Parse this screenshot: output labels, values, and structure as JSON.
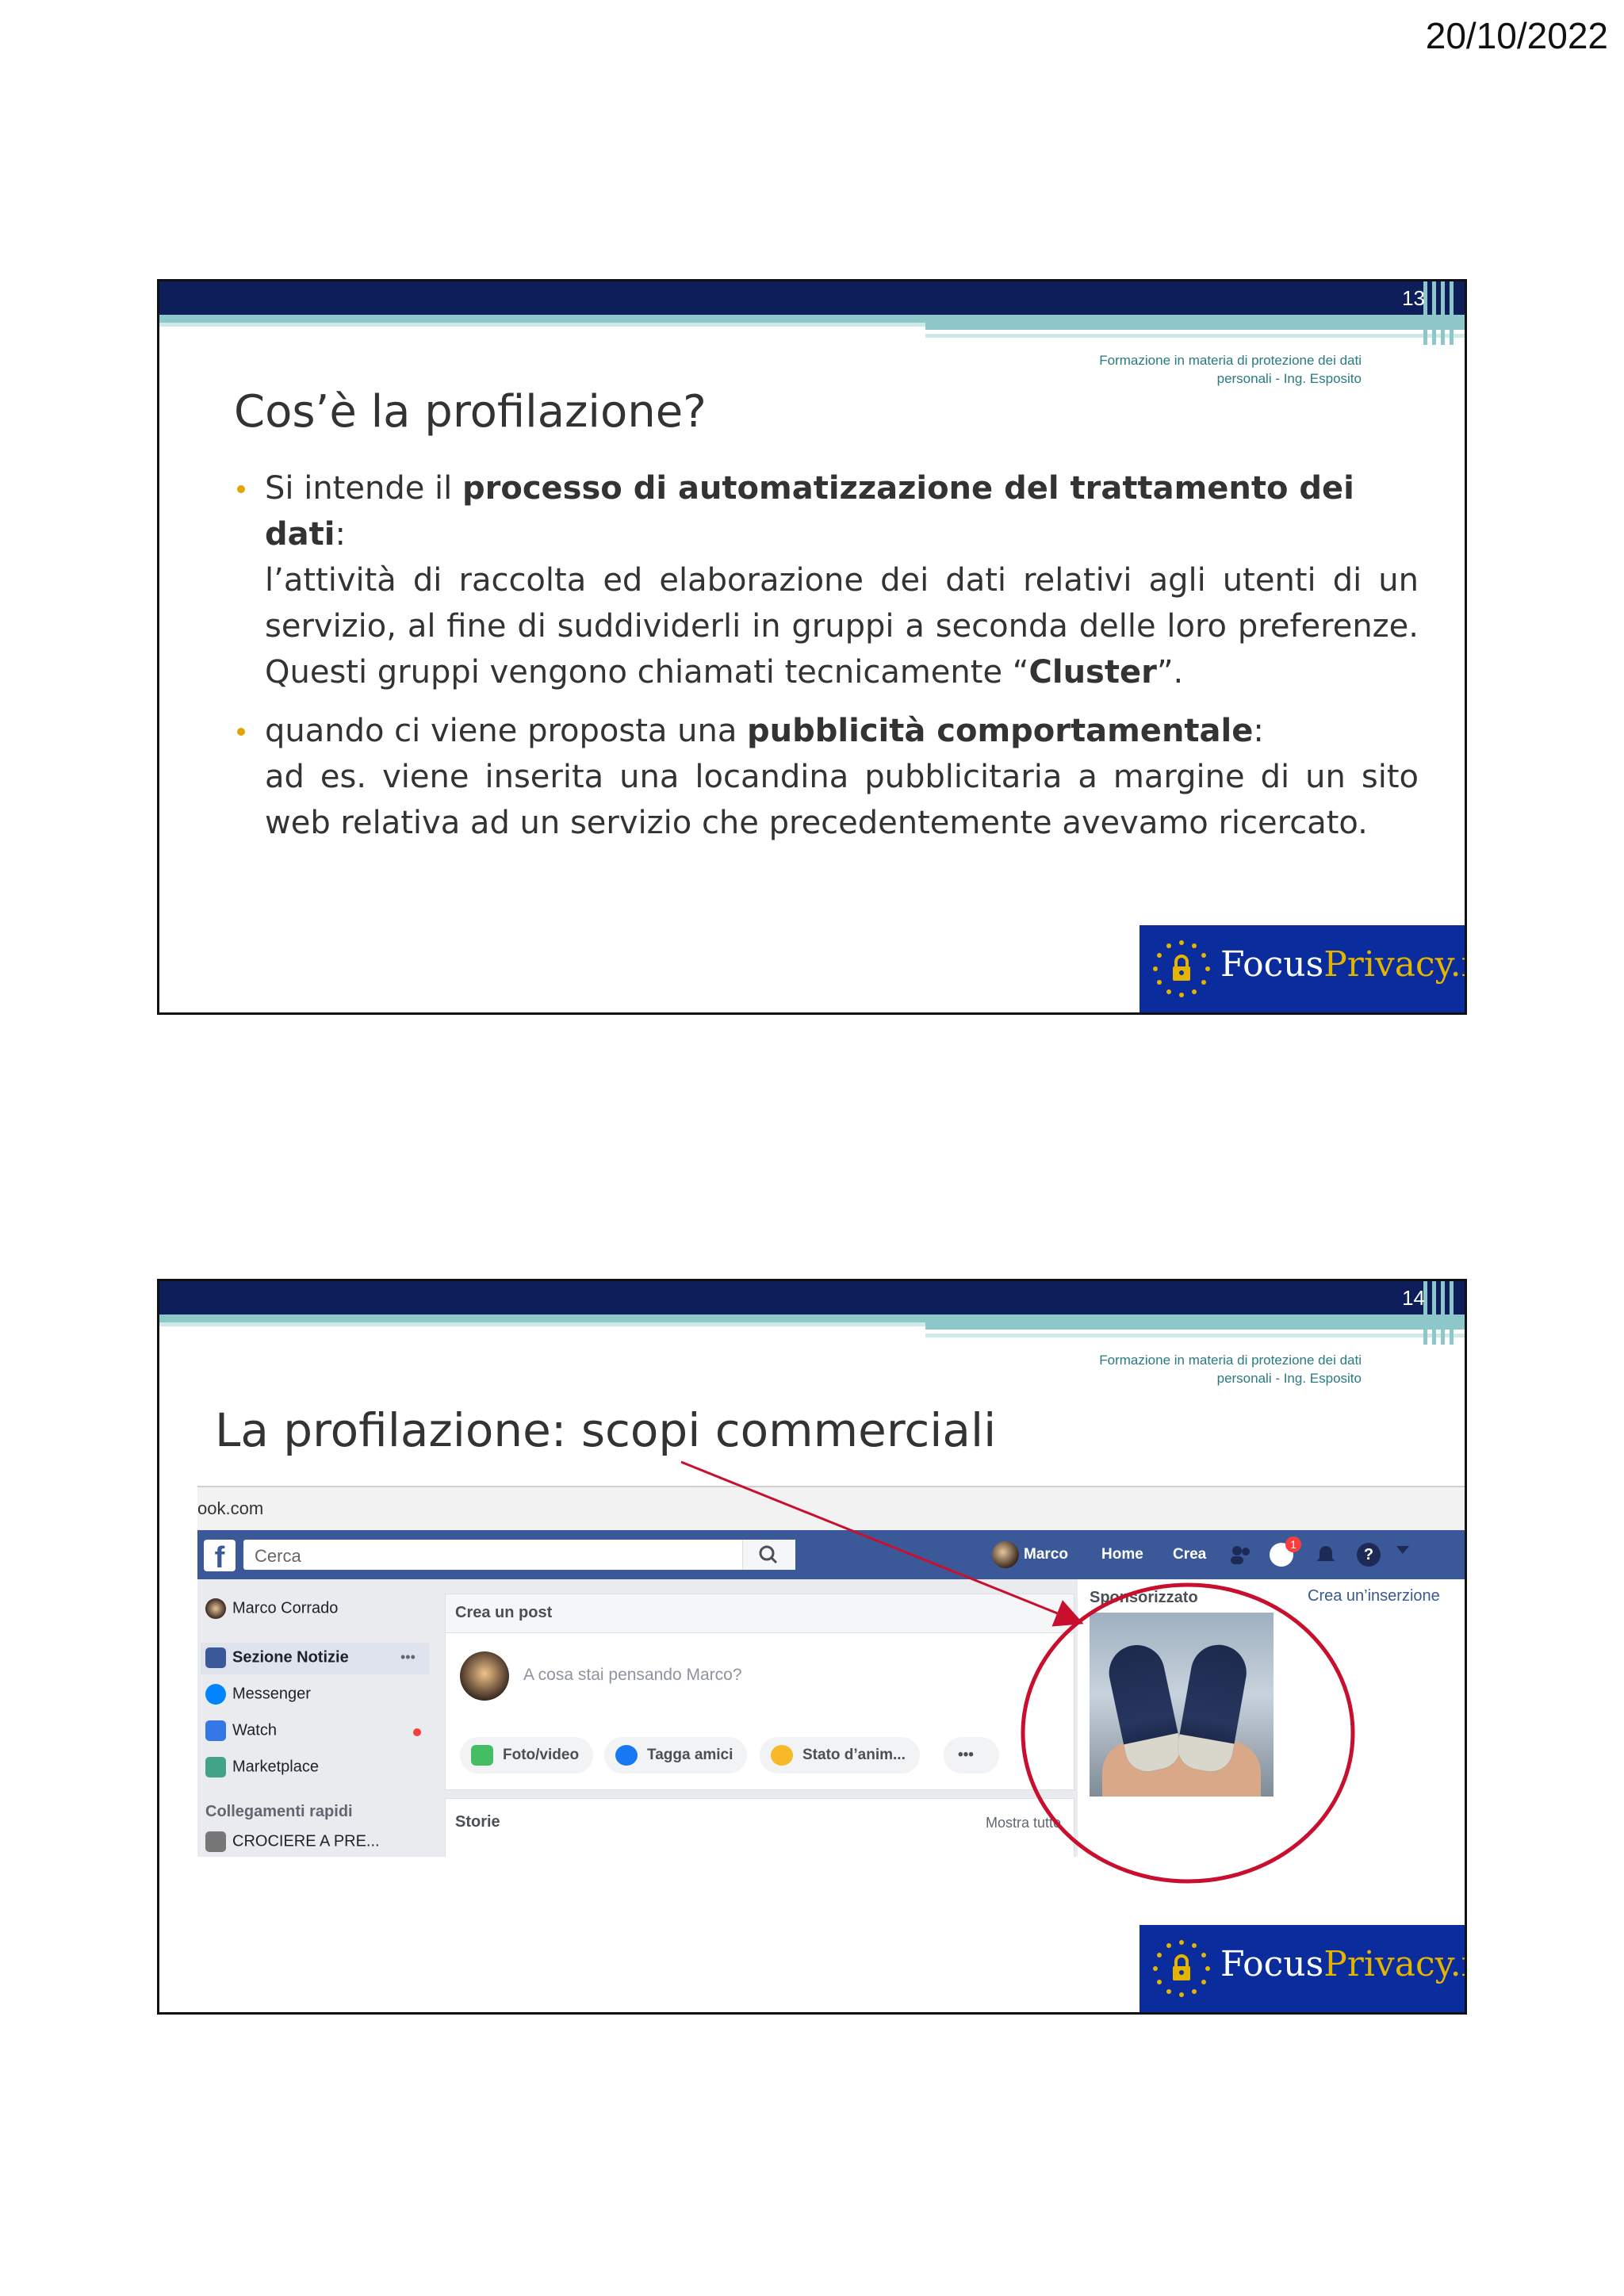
{
  "header": {
    "date": "20/10/2022"
  },
  "slides": [
    {
      "page_number": "13",
      "subtitle_line1": "Formazione in materia di protezione dei dati",
      "subtitle_line2": "personali - Ing. Esposito",
      "title": "Cos’è la profilazione?",
      "bullets": [
        {
          "lead_pre": "Si intende il ",
          "lead_bold": "processo di automatizzazione del trattamento dei dati",
          "lead_post": ":",
          "body_pre": "l’attività di raccolta ed elaborazione dei dati relativi agli utenti di un servizio, al fine di suddividerli in gruppi a seconda delle loro preferenze. Questi gruppi vengono chiamati tecnicamente “",
          "body_bold": "Cluster",
          "body_post": "”."
        },
        {
          "lead_pre": "quando ci viene proposta una ",
          "lead_bold": "pubblicità comportamentale",
          "lead_post": ":",
          "body_pre": "ad es. viene inserita una locandina pubblicitaria a margine di un sito web relativa ad un servizio che precedentemente avevamo ricercato.",
          "body_bold": "",
          "body_post": ""
        }
      ],
      "logo": {
        "part1": "Focus",
        "part2": "Privacy.it"
      }
    },
    {
      "page_number": "14",
      "subtitle_line1": "Formazione in materia di protezione dei dati",
      "subtitle_line2": "personali - Ing. Esposito",
      "title": "La profilazione: scopi commerciali",
      "logo": {
        "part1": "Focus",
        "part2": "Privacy.it"
      }
    }
  ],
  "facebook": {
    "url": "ook.com",
    "search_placeholder": "Cerca",
    "nav": {
      "user": "Marco",
      "home": "Home",
      "create": "Crea",
      "notif_count": "1"
    },
    "left": {
      "profile": "Marco Corrado",
      "items": [
        "Sezione Notizie",
        "Messenger",
        "Watch",
        "Marketplace"
      ],
      "more": "•••",
      "shortcuts_title": "Collegamenti rapidi",
      "shortcut_1": "CROCIERE A PRE..."
    },
    "composer": {
      "title": "Crea un post",
      "placeholder": "A cosa stai pensando Marco?",
      "buttons": [
        "Foto/video",
        "Tagga amici",
        "Stato d’anim..."
      ],
      "more": "•••"
    },
    "stories": {
      "title": "Storie",
      "show_all": "Mostra tutte"
    },
    "sponsored": {
      "title": "Sponsorizzato",
      "create_ad": "Crea un’inserzione"
    }
  },
  "colors": {
    "brand_navy": "#0d1e5a",
    "teal": "#8ec7c9",
    "logo_blue": "#0b2c9c",
    "bullet_gold": "#e0a600",
    "annotation_red": "#c8102e",
    "facebook_blue": "#3b5998"
  }
}
